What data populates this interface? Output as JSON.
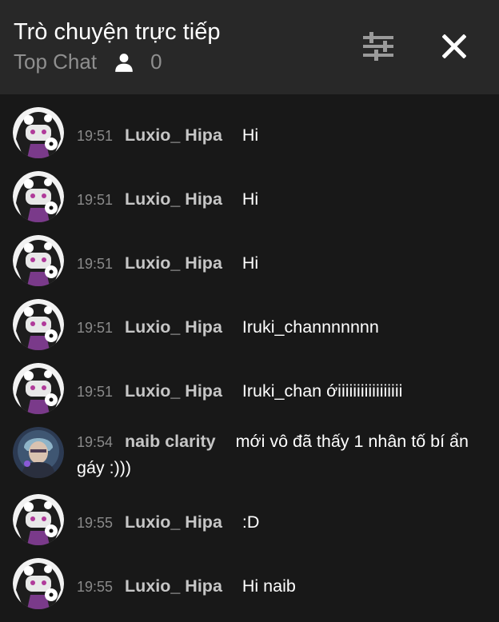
{
  "header": {
    "title": "Trò chuyện trực tiếp",
    "mode": "Top Chat",
    "viewer_count": "0",
    "icons": [
      "person-icon",
      "filter-sliders-icon",
      "close-icon"
    ]
  },
  "messages": [
    {
      "time": "19:51",
      "author": "Luxio_ Hipa",
      "text": "Hi",
      "avatar": "luxio-avatar"
    },
    {
      "time": "19:51",
      "author": "Luxio_ Hipa",
      "text": "Hi",
      "avatar": "luxio-avatar"
    },
    {
      "time": "19:51",
      "author": "Luxio_ Hipa",
      "text": "Hi",
      "avatar": "luxio-avatar"
    },
    {
      "time": "19:51",
      "author": "Luxio_ Hipa",
      "text": "Iruki_channnnnnn",
      "avatar": "luxio-avatar"
    },
    {
      "time": "19:51",
      "author": "Luxio_ Hipa",
      "text": "Iruki_chan ớiiiiiiiiiiiiiiiii",
      "avatar": "luxio-avatar"
    },
    {
      "time": "19:54",
      "author": "naib clarity",
      "text": "mới vô đã thấy 1 nhân tố bí ẩn gáy :)))",
      "avatar": "naib-avatar"
    },
    {
      "time": "19:55",
      "author": "Luxio_ Hipa",
      "text": ":D",
      "avatar": "luxio-avatar"
    },
    {
      "time": "19:55",
      "author": "Luxio_ Hipa",
      "text": "Hi naib",
      "avatar": "luxio-avatar"
    }
  ],
  "colors": {
    "header_bg": "#282828",
    "chat_bg": "#181818",
    "author": "#c6c6c6",
    "timestamp": "#8a8a8a",
    "subtitle": "#8f8f8f"
  }
}
